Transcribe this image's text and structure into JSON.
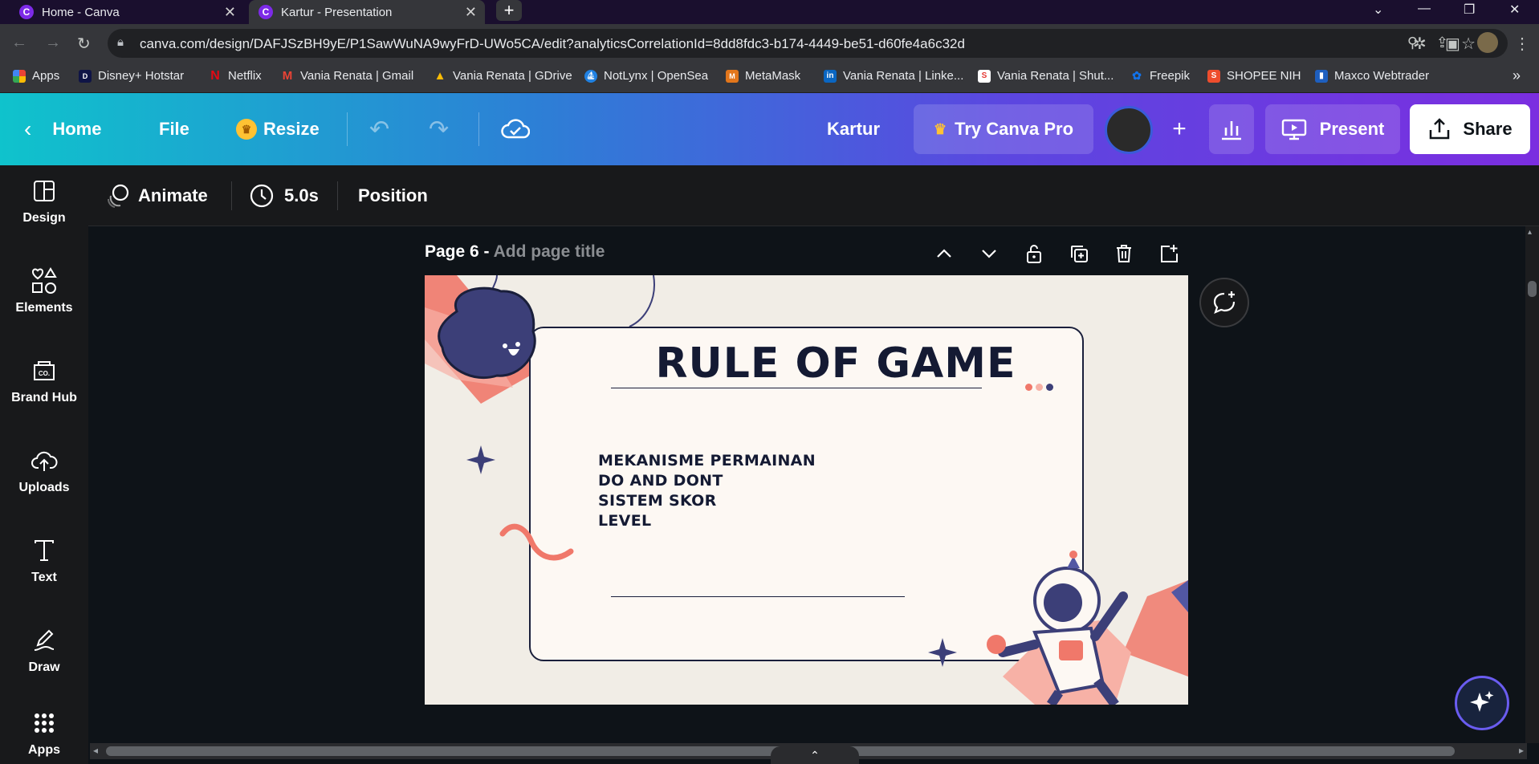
{
  "browser": {
    "tabs": [
      {
        "title": "Home - Canva",
        "favicon": "canva-icon",
        "active": false
      },
      {
        "title": "Kartur - Presentation",
        "favicon": "canva-icon",
        "active": true
      }
    ],
    "new_tab": "+",
    "url": "canva.com/design/DAFJSzBH9yE/P1SawWuNA9wyFrD-UWo5CA/edit?analyticsCorrelationId=8dd8fdc3-b174-4449-be51-d60fe4a6c32d",
    "bookmarks": [
      {
        "label": "Apps",
        "icon": "apps-grid-icon"
      },
      {
        "label": "Disney+ Hotstar",
        "icon": "hotstar-icon"
      },
      {
        "label": "Netflix",
        "icon": "netflix-icon"
      },
      {
        "label": "Vania Renata | Gmail",
        "icon": "gmail-icon"
      },
      {
        "label": "Vania Renata | GDrive",
        "icon": "gdrive-icon"
      },
      {
        "label": "NotLynx | OpenSea",
        "icon": "opensea-icon"
      },
      {
        "label": "MetaMask",
        "icon": "metamask-icon"
      },
      {
        "label": "Vania Renata | Linke...",
        "icon": "linkedin-icon"
      },
      {
        "label": "Vania Renata | Shut...",
        "icon": "shutterstock-icon"
      },
      {
        "label": "Freepik",
        "icon": "freepik-icon"
      },
      {
        "label": "SHOPEE NIH",
        "icon": "shopee-icon"
      },
      {
        "label": "Maxco Webtrader",
        "icon": "chart-icon"
      }
    ],
    "bookmarks_overflow": "»"
  },
  "header": {
    "home": "Home",
    "file": "File",
    "resize": "Resize",
    "doc_title": "Kartur",
    "try_pro": "Try Canva Pro",
    "present": "Present",
    "share": "Share"
  },
  "sidebar": {
    "items": [
      {
        "label": "Design",
        "icon": "design-layout-icon"
      },
      {
        "label": "Elements",
        "icon": "elements-shapes-icon"
      },
      {
        "label": "Brand Hub",
        "icon": "brand-hub-icon"
      },
      {
        "label": "Uploads",
        "icon": "upload-cloud-icon"
      },
      {
        "label": "Text",
        "icon": "text-t-icon"
      },
      {
        "label": "Draw",
        "icon": "draw-pen-icon"
      },
      {
        "label": "Apps",
        "icon": "apps-grid-icon"
      }
    ]
  },
  "toolbar": {
    "animate": "Animate",
    "duration": "5.0s",
    "position": "Position"
  },
  "page": {
    "label": "Page 6 - ",
    "title_placeholder": "Add page title"
  },
  "slide": {
    "title": "RULE OF GAME",
    "items": [
      "MEKANISME PERMAINAN",
      "DO AND DONT",
      "SISTEM SKOR",
      "LEVEL"
    ]
  },
  "colors": {
    "accent_salmon": "#f0786a",
    "navy": "#3c3f78",
    "card_border": "#1a1f3b"
  }
}
